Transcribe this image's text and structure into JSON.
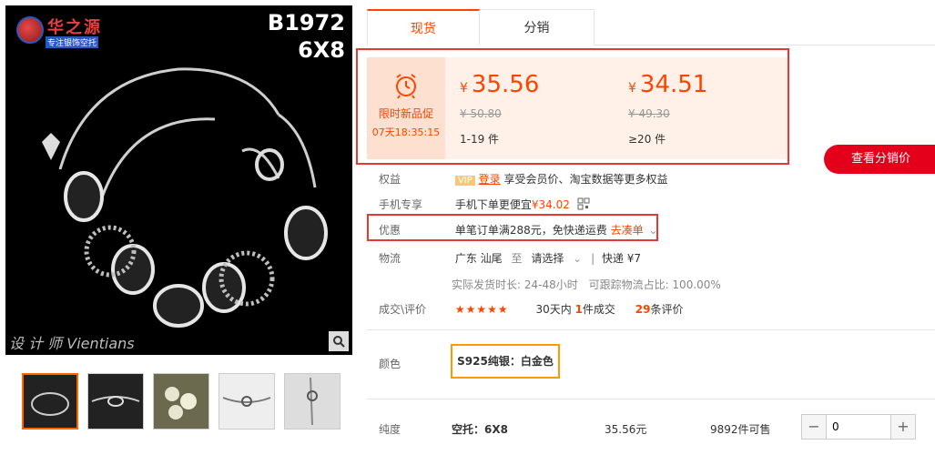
{
  "image": {
    "logo_text": "华之源",
    "logo_sub": "专注银饰空托",
    "code_line1": "B1972",
    "code_line2": "6X8",
    "watermark": "设 计 师 Vientians"
  },
  "tabs": [
    {
      "label": "现货"
    },
    {
      "label": "分销"
    }
  ],
  "promo": {
    "badge_title": "限时新品促",
    "countdown": "07天18:35:15",
    "tier1": {
      "price": "35.56",
      "old_price": "¥ 50.80",
      "qty": "1-19 件"
    },
    "tier2": {
      "price": "34.51",
      "old_price": "¥ 49.30",
      "qty": "≥20 件"
    },
    "currency": "¥"
  },
  "dist_button": "查看分销价",
  "benefits": {
    "label": "权益",
    "vip": "VIP",
    "login": "登录",
    "text": "享受会员价、淘宝数据等更多权益"
  },
  "mobile": {
    "label": "手机专享",
    "text": "手机下单更便宜",
    "price": "¥34.02"
  },
  "coupon": {
    "label": "优惠",
    "text": "单笔订单满288元，免快递运费",
    "action": "去凑单"
  },
  "logistics": {
    "label": "物流",
    "origin": "广东 汕尾",
    "to": "至",
    "dest": "请选择",
    "express": "快递 ¥7",
    "ship_time": "实际发货时长: 24-48小时",
    "track_rate": "可跟踪物流占比: 100.00%"
  },
  "reviews": {
    "label": "成交\\评价",
    "stars": "★★★★★",
    "days": "30天内",
    "count": "1",
    "count_suffix": "件成交",
    "reviews": "29",
    "reviews_suffix": "条评价"
  },
  "color": {
    "label": "颜色",
    "option": "S925纯银：白金色"
  },
  "purity": {
    "label": "纯度",
    "spec": "空托：6X8",
    "price": "35.56元",
    "stock": "9892件可售",
    "qty": "0"
  }
}
